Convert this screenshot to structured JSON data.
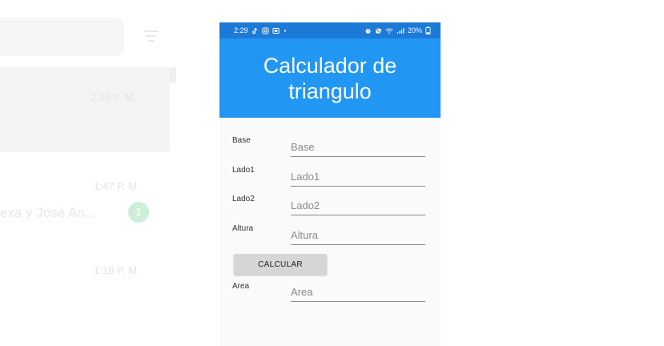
{
  "background_app": {
    "times": [
      "2:30 P. M.",
      "1:47 P. M.",
      "1:19 P. M."
    ],
    "chat_name": "exa y José An...",
    "unread_badge": "1"
  },
  "status_bar": {
    "time": "2:29",
    "left_icons": [
      "tiktok-icon",
      "instagram-icon",
      "gallery-icon",
      "dot-icon"
    ],
    "right_icons": [
      "alarm-icon",
      "mute-icon",
      "wifi-icon",
      "signal-icon"
    ],
    "battery": "20%"
  },
  "app": {
    "title": "Calculador de triangulo",
    "primary_color": "#2196f3"
  },
  "form": {
    "fields": [
      {
        "label": "Base",
        "placeholder": "Base",
        "value": ""
      },
      {
        "label": "Lado1",
        "placeholder": "Lado1",
        "value": ""
      },
      {
        "label": "Lado2",
        "placeholder": "Lado2",
        "value": ""
      },
      {
        "label": "Altura",
        "placeholder": "Altura",
        "value": ""
      }
    ],
    "calculate_button": "CALCULAR",
    "result": {
      "label": "Area",
      "placeholder": "Area",
      "value": ""
    }
  }
}
